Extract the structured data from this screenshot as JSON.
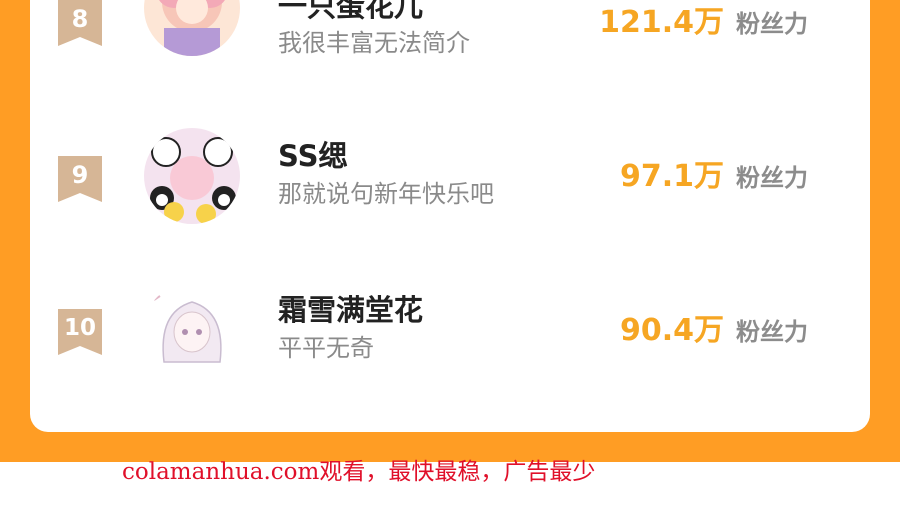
{
  "ranking": {
    "entries": [
      {
        "rank": "8",
        "name": "一只蛋花儿",
        "bio": "我很丰富无法简介",
        "fans": "121.4万",
        "fans_unit": "粉丝力"
      },
      {
        "rank": "9",
        "name": "SS缌",
        "bio": "那就说句新年快乐吧",
        "fans": "97.1万",
        "fans_unit": "粉丝力"
      },
      {
        "rank": "10",
        "name": "霜雪满堂花",
        "bio": "平平无奇",
        "fans": "90.4万",
        "fans_unit": "粉丝力"
      }
    ]
  },
  "colors": {
    "background": "#ff9d24",
    "rank_badge": "#d6b696",
    "fans_count": "#f6a623",
    "watermark": "#e0102a"
  },
  "icons": [
    "rank-ribbon-icon"
  ],
  "watermark": {
    "text": "colamanhua.com观看，最快最稳，广告最少"
  }
}
